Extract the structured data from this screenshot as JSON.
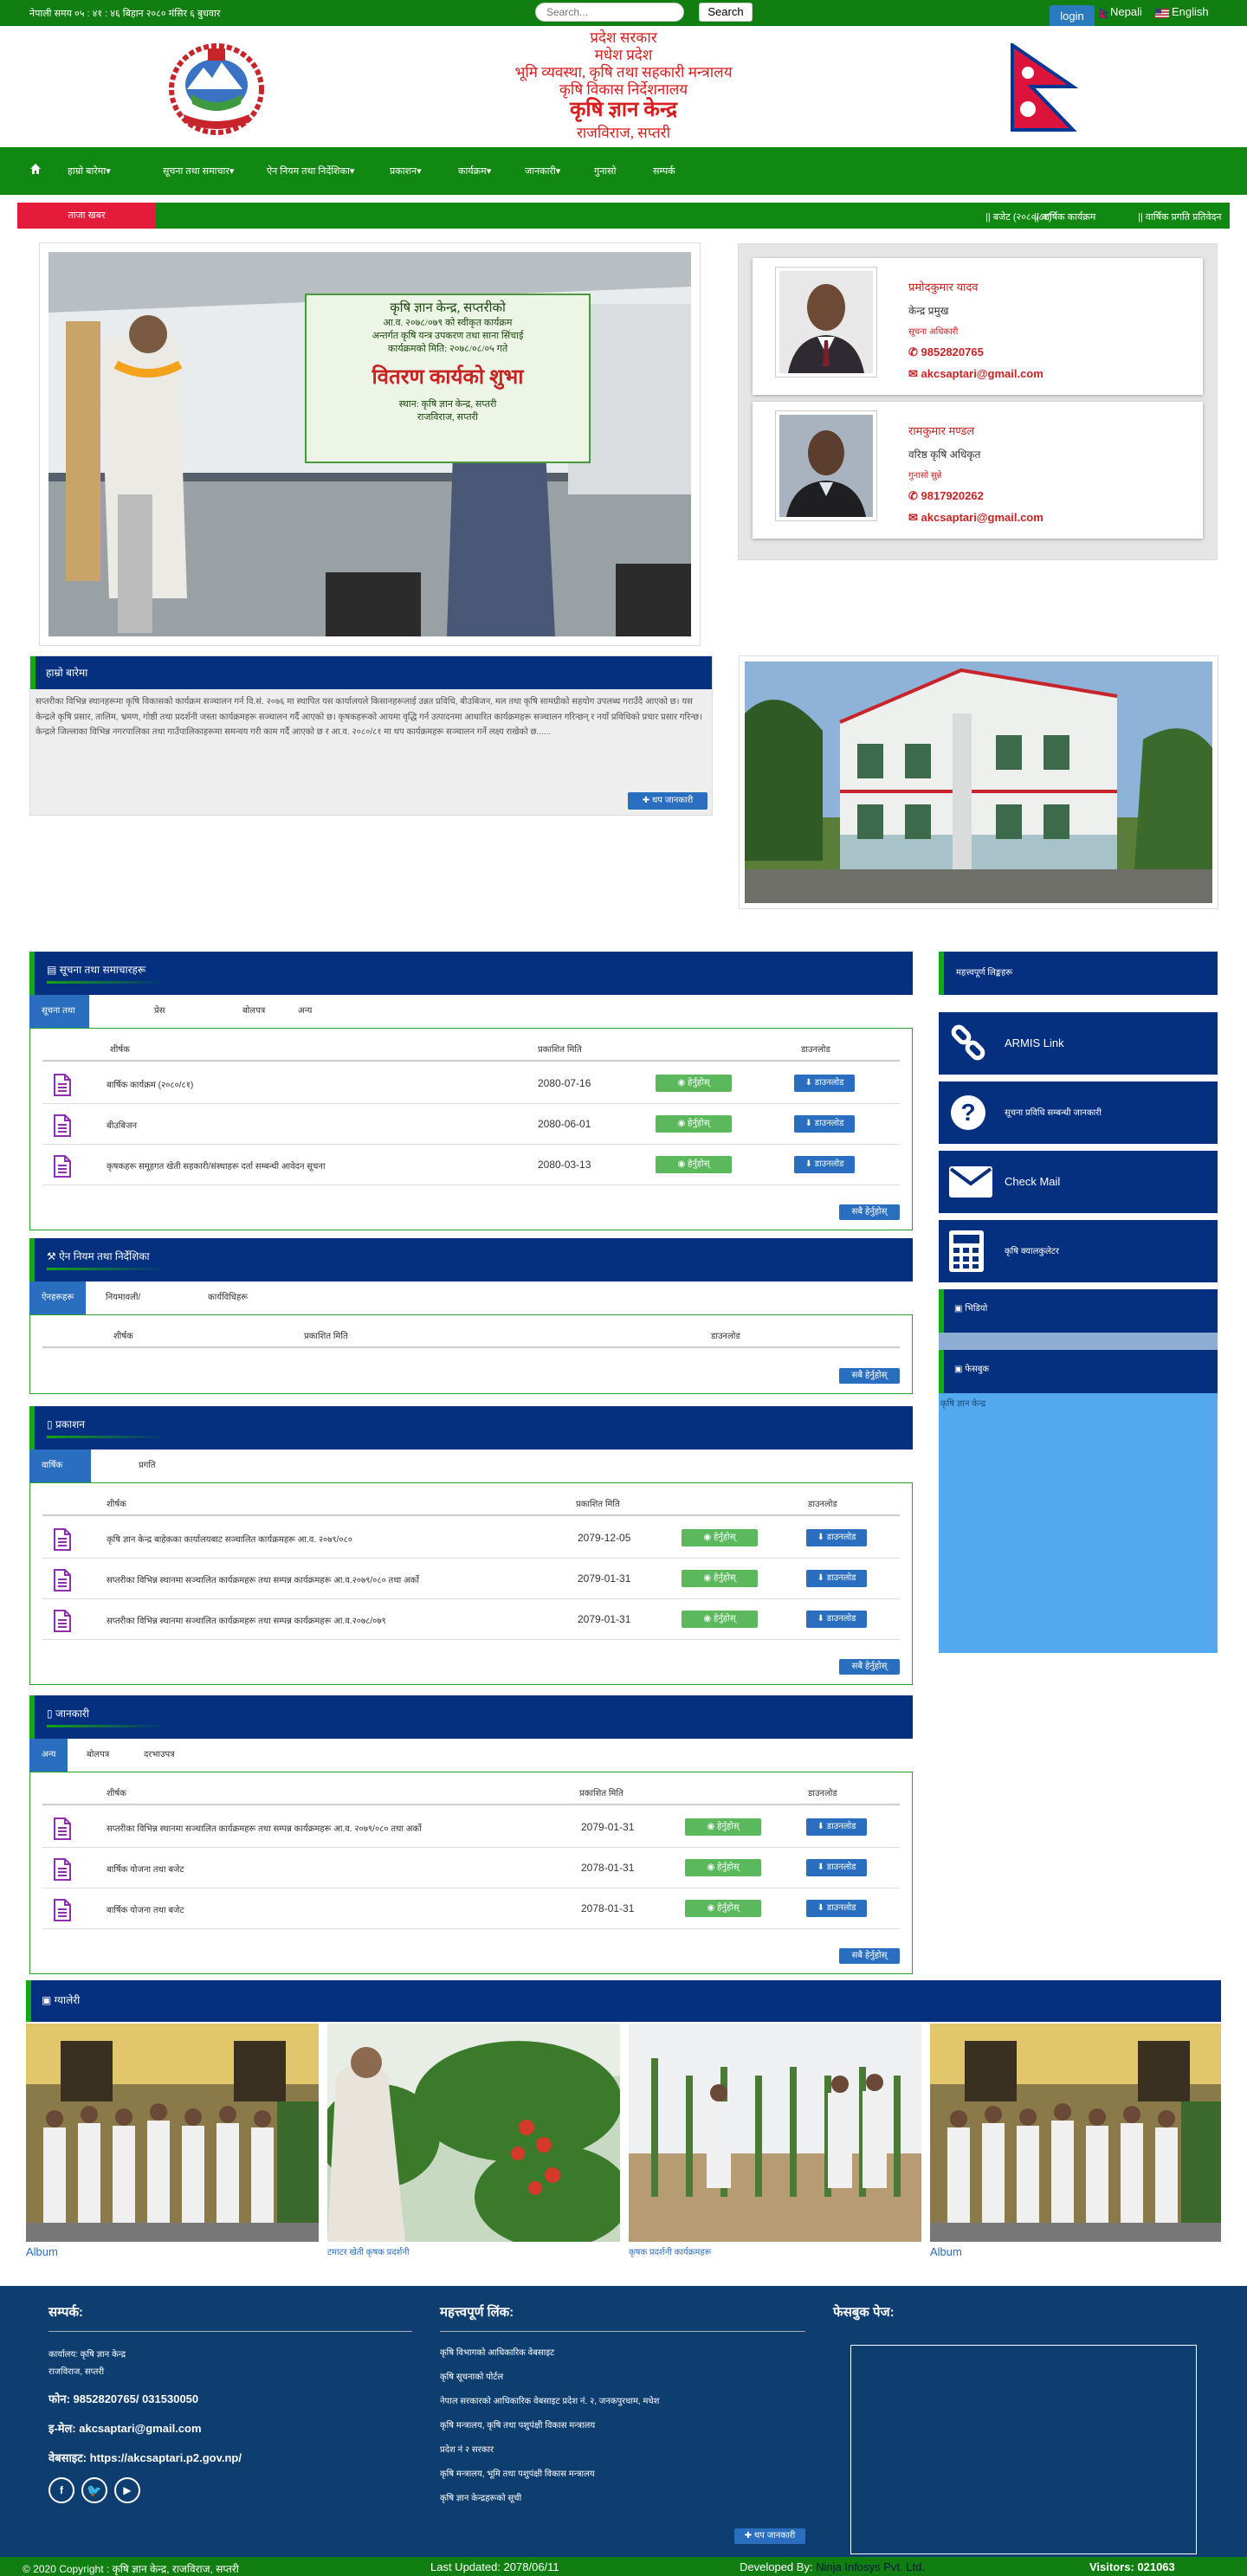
{
  "topbar": {
    "time": "नेपाली समय ०५ : ४१ : ४६ बिहान   २०८० मंसिर ६ बुधवार",
    "search_placeholder": "Search...",
    "search_button": "Search",
    "login": "login",
    "lang_nepali": "Nepali",
    "lang_english": "English"
  },
  "header": {
    "line1": "प्रदेश सरकार",
    "line2": "मधेश प्रदेश",
    "line3": "भूमि व्यवस्था, कृषि तथा सहकारी मन्त्रालय",
    "line4": "कृषि विकास निर्देशनालय",
    "line5": "कृषि ज्ञान केन्द्र",
    "line6": "राजविराज, सप्तरी"
  },
  "nav": {
    "home_icon": "home-icon",
    "items": [
      "हाम्रो बारेमा▾",
      "सूचना तथा समाचार▾",
      "ऐन नियम तथा निर्देशिका▾",
      "प्रकाशन▾",
      "कार्यक्रम▾",
      "जानकारी▾",
      "गुनासो",
      "सम्पर्क"
    ]
  },
  "ticker": {
    "label": "ताजा खबर",
    "items": [
      "|| बजेट (२०८०/८१)",
      "|| बार्षिक कार्यक्रम",
      "|| वार्षिक प्रगति प्रतिवेदन"
    ]
  },
  "slider": {
    "caption_banner": "कृषि ज्ञान केन्द्र, सप्तरीको",
    "banner_line2": "आ.व. २०७८/०७९ को स्वीकृत कार्यक्रम",
    "banner_line3": "अन्तर्गत कृषि यन्त्र उपकरण तथा साना सिंचाई",
    "banner_line4": "कार्यक्रमको मिति: २०७८/०८/०५ गते",
    "banner_main": "वितरण कार्यको शुभा",
    "banner_line5": "स्थान: कृषि ज्ञान केन्द्र, सप्तरी",
    "banner_line6": "राजविराज, सप्तरी"
  },
  "staff": [
    {
      "name": "प्रमोदकुमार यादव",
      "designation": "केन्द्र प्रमुख",
      "role": "सूचना अधिकारी",
      "phone": "9852820765",
      "email": "akcsaptari@gmail.com"
    },
    {
      "name": "रामकुमार मण्डल",
      "designation": "वरिष्ठ कृषि अधिकृत",
      "role": "गुनासो सुन्ने",
      "phone": "9817920262",
      "email": "akcsaptari@gmail.com"
    }
  ],
  "intro": {
    "title": "हाम्रो बारेमा",
    "body": "सप्तरीका विभिन्न स्थानहरूमा कृषि विकासको कार्यक्रम सञ्चालन गर्न वि.सं. २०७६ मा स्थापित यस कार्यालयले किसानहरूलाई उन्नत प्रविधि, बीउबिजन, मल तथा कृषि सामग्रीको सहयोग उपलब्ध गराउँदै आएको छ। यस केन्द्रले कृषि प्रसार, तालिम, भ्रमण, गोष्ठी तथा प्रदर्शनी जस्ता कार्यक्रमहरू सञ्चालन गर्दै आएको छ। कृषकहरूको आयमा वृद्धि गर्न उत्पादनमा आधारित कार्यक्रमहरू सञ्चालन गरिन्छन् र नयाँ प्रविधिको प्रचार प्रसार गरिन्छ। केन्द्रले जिल्लाका विभिन्न नगरपालिका तथा गाउँपालिकाहरूमा समन्वय गरी काम गर्दै आएको छ र आ.व. २०८०/८१ मा थप कार्यक्रमहरू सञ्चालन गर्ने लक्ष्य राखेको छ......",
    "more": "थप जानकारी"
  },
  "sec_news": {
    "title": "सूचना तथा समाचारहरू",
    "tabs": [
      "सूचना तथा समाचारहरू",
      "प्रेस विज्ञप्ति",
      "बोलपत्र",
      "अन्य"
    ],
    "columns": [
      "शीर्षक",
      "प्रकाशित मिति",
      "",
      "डाउनलोड"
    ],
    "rows": [
      {
        "title": "बार्षिक कार्यक्रम (२०८०/८१)",
        "date": "2080-07-16"
      },
      {
        "title": "बीउबिजन",
        "date": "2080-06-01"
      },
      {
        "title": "कृषकहरू समूहगत खेती सहकारी/संस्थाहरू दर्ता सम्बन्धी आवेदन सूचना",
        "date": "2080-03-13"
      }
    ],
    "view": "हेर्नुहोस्",
    "download": "डाउनलोड",
    "all": "सबै हेर्नुहोस्"
  },
  "sec_laws": {
    "title": "ऐन नियम तथा निर्देशिका",
    "tabs": [
      "ऐनहरूहरू",
      "नियमावली/निर्देशिका",
      "कार्यविधिहरू"
    ],
    "columns": [
      "शीर्षक",
      "प्रकाशित मिति",
      "डाउनलोड"
    ],
    "all": "सबै हेर्नुहोस्"
  },
  "sec_pub": {
    "title": "प्रकाशन",
    "tabs": [
      "वार्षिक प्रतिवेदनहरू",
      "प्रगति विवरण तथा प्रतिवेदन"
    ],
    "columns": [
      "शीर्षक",
      "प्रकाशित मिति",
      "डाउनलोड"
    ],
    "rows": [
      {
        "title": "कृषि ज्ञान केन्द्र बाहेकका कार्यालयबाट सञ्चालित कार्यक्रमहरू आ.व. २०७९/०८०",
        "date": "2079-12-05"
      },
      {
        "title": "सप्तरीका विभिन्न स्थानमा सञ्चालित कार्यक्रमहरू तथा सम्पन्न कार्यक्रमहरू आ.व.२०७९/०८० तथा अर्को",
        "date": "2079-01-31"
      },
      {
        "title": "सप्तरीका विभिन्न स्थानमा सञ्चालित कार्यक्रमहरू तथा सम्पन्न कार्यक्रमहरू आ.व.२०७८/०७९",
        "date": "2079-01-31"
      }
    ],
    "view": "हेर्नुहोस्",
    "download": "डाउनलोड",
    "all": "सबै हेर्नुहोस्"
  },
  "sec_info": {
    "title": "जानकारी",
    "tabs": [
      "अन्य",
      "बोलपत्र",
      "दरभाउपत्र"
    ],
    "columns": [
      "शीर्षक",
      "प्रकाशित मिति",
      "डाउनलोड"
    ],
    "rows": [
      {
        "title": "सप्तरीका विभिन्न स्थानमा सञ्चालित कार्यक्रमहरू तथा सम्पन्न कार्यक्रमहरू आ.व. २०७९/०८० तथा अर्को",
        "date": "2079-01-31"
      },
      {
        "title": "बार्षिक योजना तथा बजेट",
        "date": "2078-01-31"
      },
      {
        "title": "बार्षिक योजना तथा बजेट",
        "date": "2078-01-31"
      }
    ],
    "view": "हेर्नुहोस्",
    "download": "डाउनलोड",
    "all": "सबै हेर्नुहोस्"
  },
  "sidebar": {
    "title": "महत्त्वपूर्ण लिङ्कहरू",
    "links": [
      {
        "label": "ARMIS Link",
        "icon": "chain-link-icon"
      },
      {
        "label": "सूचना प्रविधि सम्बन्धी जानकारी",
        "icon": "question-icon"
      },
      {
        "label": "Check Mail",
        "icon": "envelope-icon"
      },
      {
        "label": "कृषि क्यालकुलेटर",
        "icon": "calculator-icon"
      }
    ],
    "box1": "भिडियो",
    "box2": "फेसबुक",
    "box2_text": "कृषि ज्ञान केन्द्र"
  },
  "gallery": {
    "title": "ग्यालेरी",
    "items": [
      {
        "caption": "Album"
      },
      {
        "caption": "टमाटर खेती कृषक प्रदर्शनी"
      },
      {
        "caption": "कृषक प्रदर्शनी कार्यक्रमहरू"
      },
      {
        "caption": "Album"
      }
    ]
  },
  "footer": {
    "contact_title": "सम्पर्क:",
    "office": "कार्यालय: कृषि ज्ञान केन्द्र",
    "address": "राजविराज, सप्तरी",
    "phone": "फोन: 9852820765/ 031530050",
    "email": "इ-मेल: akcsaptari@gmail.com",
    "website": "वेबसाइट: https://akcsaptari.p2.gov.np/",
    "links_title": "महत्त्वपूर्ण लिंक:",
    "links": [
      "कृषि विभागको आधिकारिक वेबसाइट",
      "कृषि सूचनाको पोर्टल",
      "नेपाल सरकारको आधिकारिक वेबसाइट प्रदेश नं. २, जनकपुरधाम, मधेश",
      "कृषि मन्त्रालय, कृषि तथा पशुपंक्षी विकास मन्त्रालय",
      "प्रदेश नं २ सरकार",
      "कृषि मन्त्रालय, भूमि तथा पशुपंक्षी विकास मन्त्रालय",
      "कृषि ज्ञान केन्द्रहरूको सूची"
    ],
    "links_more": "थप जानकारी",
    "fb_title": "फेसबुक पेज:"
  },
  "copybar": {
    "copyright": "© 2020 Copyright : कृषि ज्ञान केन्द्र, राजविराज, सप्तरी",
    "updated": "Last Updated: 2078/06/11",
    "dev_label": "Developed By:",
    "dev_name": "Ninja Infosys Pvt. Ltd.",
    "visitors": "Visitors: 021063"
  },
  "colors": {
    "green": "#117e11",
    "navy": "#052f7f",
    "red": "#d81e1e",
    "footer": "#0e3e70"
  }
}
